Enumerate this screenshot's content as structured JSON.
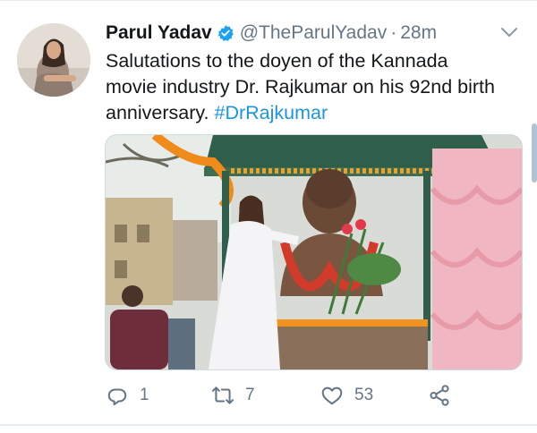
{
  "tweet": {
    "author": {
      "name": "Parul Yadav",
      "handle": "@TheParulYadav",
      "verified": true
    },
    "separator": "·",
    "time": "28m",
    "text_lines": [
      "Salutations to the doyen of the Kannada",
      "movie industry Dr. Rajkumar on his 92nd birth",
      "anniversary. "
    ],
    "hashtag": "#DrRajkumar",
    "actions": {
      "replies": "1",
      "retweets": "7",
      "likes": "53"
    }
  },
  "colors": {
    "link": "#1b95e0",
    "secondary_text": "#657786",
    "verified_badge": "#1da1f2",
    "divider": "#e6ecf0"
  },
  "icons": [
    "chevron-down-icon",
    "verified-icon",
    "reply-icon",
    "retweet-icon",
    "like-icon",
    "share-icon"
  ]
}
